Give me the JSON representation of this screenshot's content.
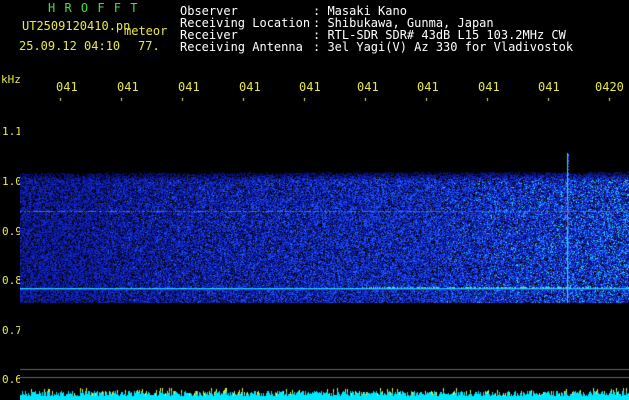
{
  "header": {
    "station": "H R O F F T",
    "filename": "UT2509120410.pn",
    "mode": "meteor",
    "date_time": "25.09.12 04:10",
    "count": "77.",
    "labels": [
      "Observer",
      "Receiving Location",
      "Receiver",
      "Receiving Antenna"
    ],
    "values": [
      ": Masaki Kano",
      ": Shibukawa, Gunma, Japan",
      ": RTL-SDR SDR# 43dB L15 103.2MHz CW",
      ": 3el Yagi(V) Az 330 for Vladivostok"
    ]
  },
  "axis": {
    "unit": "kHz",
    "y_labels": [
      "1.1",
      "1.0",
      "0.9",
      "0.8",
      "0.7",
      "0.6"
    ],
    "x_labels": [
      "041",
      "041",
      "041",
      "041",
      "041",
      "041",
      "041",
      "041",
      "041",
      "0420"
    ]
  },
  "colors": {
    "background": "#000000",
    "text_white": "#ffffff",
    "text_yellow": "#e8e84a",
    "text_green": "#3fe03f",
    "noise_dark": "#0a1a8a",
    "noise_light": "#2a5aff",
    "signal_line": "#38d8ff",
    "meteor": "#ff3030",
    "bottom_bar": "#00e8ff"
  }
}
